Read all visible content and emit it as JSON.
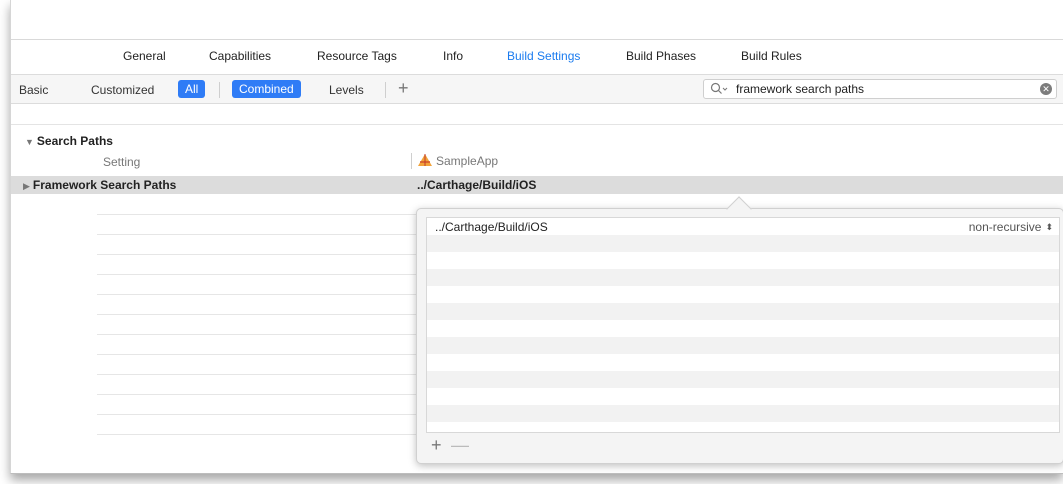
{
  "tabs": [
    {
      "label": "General",
      "active": false
    },
    {
      "label": "Capabilities",
      "active": false
    },
    {
      "label": "Resource Tags",
      "active": false
    },
    {
      "label": "Info",
      "active": false
    },
    {
      "label": "Build Settings",
      "active": true
    },
    {
      "label": "Build Phases",
      "active": false
    },
    {
      "label": "Build Rules",
      "active": false
    }
  ],
  "filters": {
    "basic": "Basic",
    "customized": "Customized",
    "all": "All",
    "combined": "Combined",
    "levels": "Levels",
    "add": "+"
  },
  "search": {
    "value": "framework search paths",
    "icon": "search-icon",
    "clear_icon": "clear-icon"
  },
  "section": {
    "title": "Search Paths",
    "setting_header": "Setting",
    "target_header": "SampleApp",
    "target_icon": "app-icon"
  },
  "row": {
    "name": "Framework Search Paths",
    "value": "../Carthage/Build/iOS"
  },
  "popover": {
    "entries": [
      {
        "path": "../Carthage/Build/iOS",
        "mode": "non-recursive"
      }
    ],
    "add_label": "+",
    "remove_label": "—"
  },
  "colors": {
    "accent": "#1a7bef",
    "pill": "#2f7cf6",
    "selected_row": "#dcdcdc"
  }
}
